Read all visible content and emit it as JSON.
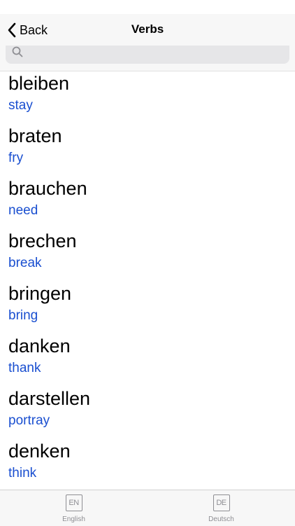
{
  "nav": {
    "back_label": "Back",
    "title": "Verbs"
  },
  "search": {
    "placeholder": "",
    "value": ""
  },
  "verbs": [
    {
      "word": "bleiben",
      "translation": "stay"
    },
    {
      "word": "braten",
      "translation": "fry"
    },
    {
      "word": "brauchen",
      "translation": "need"
    },
    {
      "word": "brechen",
      "translation": "break"
    },
    {
      "word": "bringen",
      "translation": "bring"
    },
    {
      "word": "danken",
      "translation": "thank"
    },
    {
      "word": "darstellen",
      "translation": "portray"
    },
    {
      "word": "denken",
      "translation": "think"
    }
  ],
  "tabs": [
    {
      "icon_text": "EN",
      "label": "English",
      "icon": "en-flag-icon"
    },
    {
      "icon_text": "DE",
      "label": "Deutsch",
      "icon": "de-flag-icon"
    }
  ],
  "colors": {
    "translation": "#1a4fd0",
    "tab_inactive": "#8e8e93",
    "bar_background": "#f7f7f7"
  }
}
